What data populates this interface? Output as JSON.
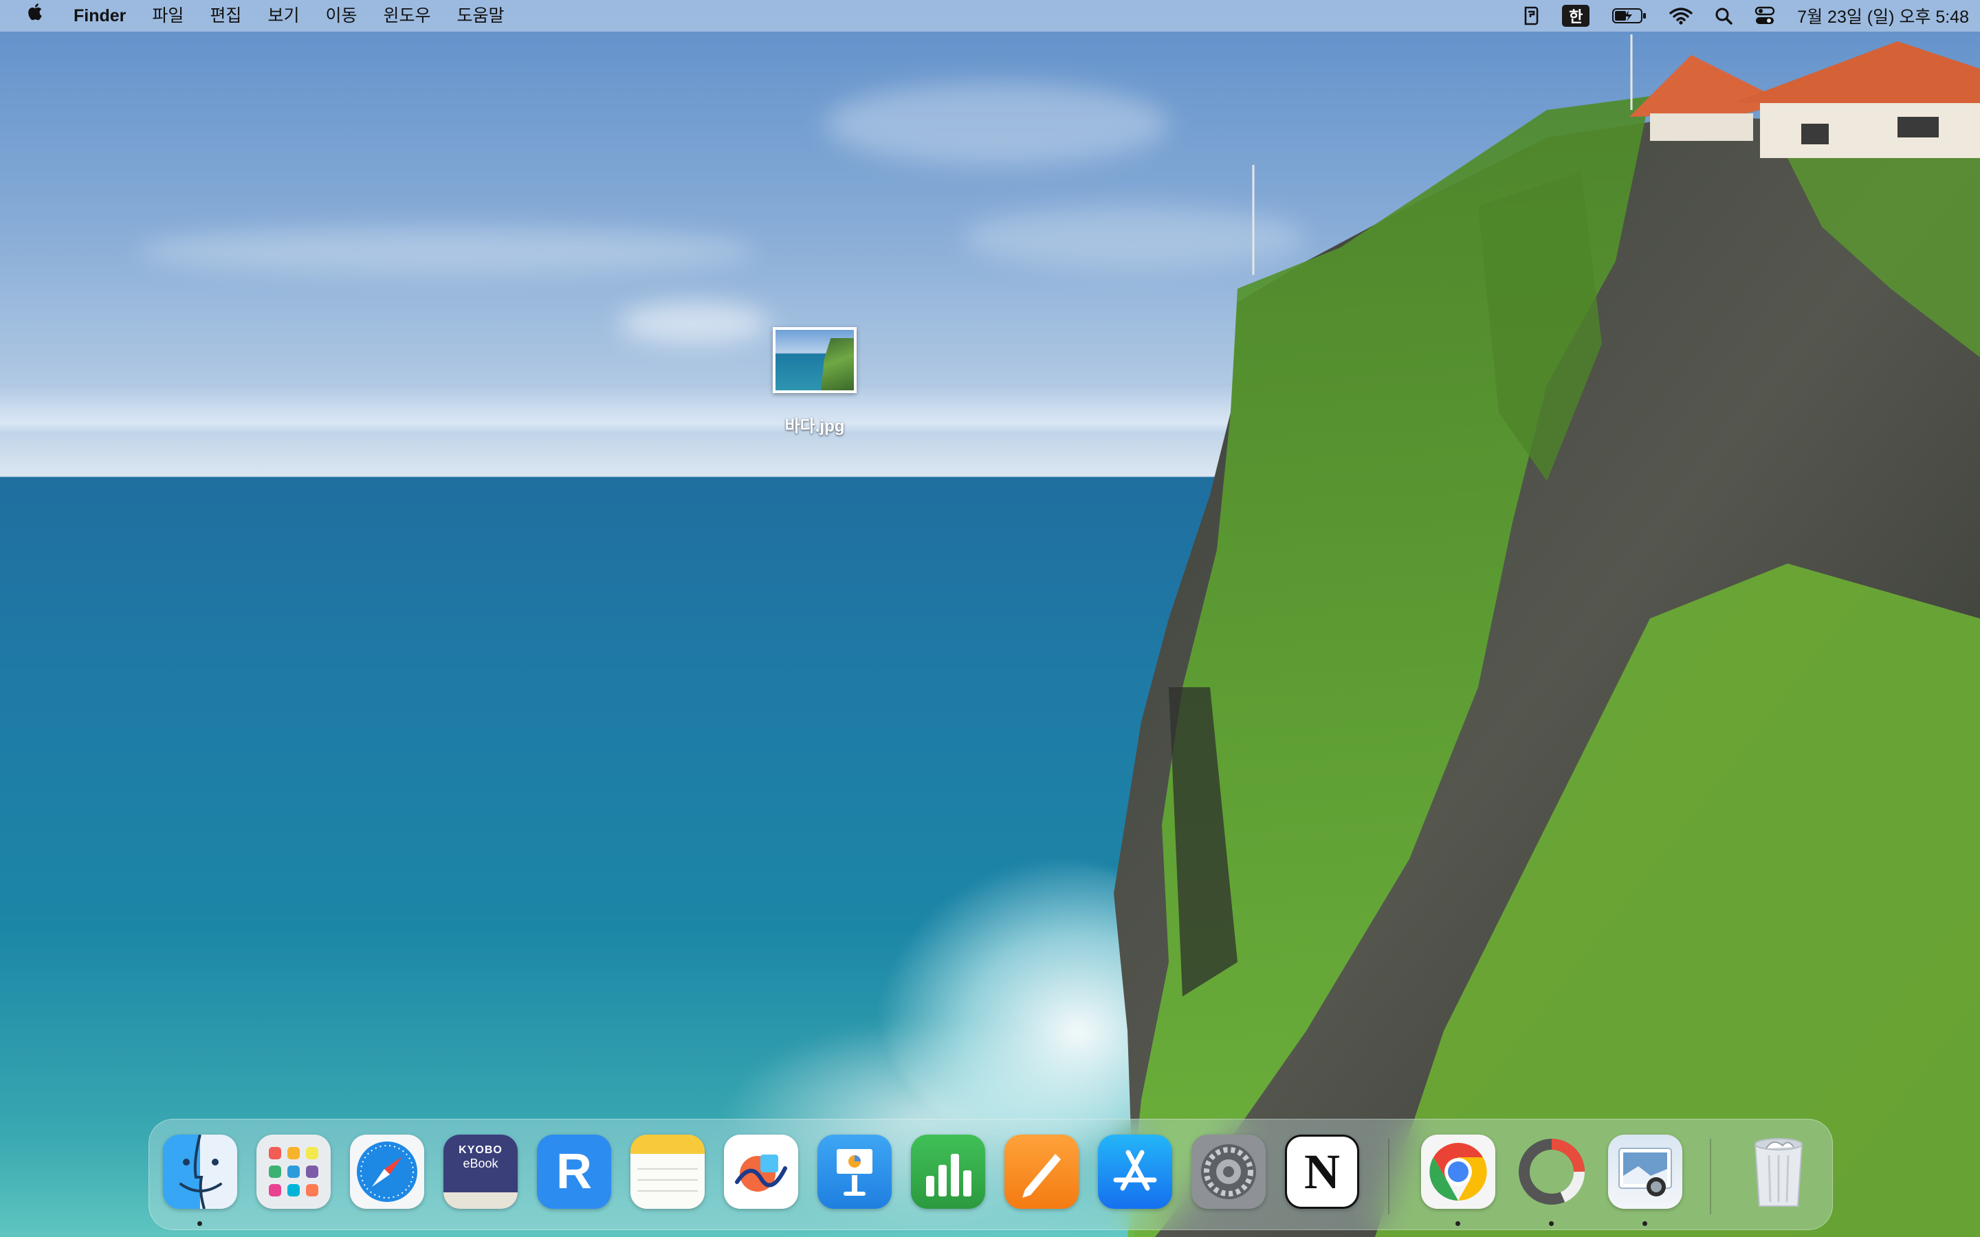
{
  "menubar": {
    "apple_icon": "apple-logo-icon",
    "app_name": "Finder",
    "items": [
      "파일",
      "편집",
      "보기",
      "이동",
      "윈도우",
      "도움말"
    ],
    "status_icons": [
      "shortcut-icon",
      "input-source-icon",
      "battery-icon",
      "wifi-icon",
      "spotlight-search-icon",
      "control-center-icon"
    ],
    "input_source": "한",
    "clock": "7월 23일 (일) 오후 5:48"
  },
  "desktop": {
    "file_name": "바다.jpg"
  },
  "dock": {
    "apps": [
      {
        "name": "Finder",
        "icon": "finder-icon",
        "running": true
      },
      {
        "name": "Launchpad",
        "icon": "launchpad-icon",
        "running": false
      },
      {
        "name": "Safari",
        "icon": "safari-icon",
        "running": false
      },
      {
        "name": "KYOBO eBook",
        "icon": "kyobo-ebook-icon",
        "running": false,
        "label_line1": "KYOBO",
        "label_line2": "eBook"
      },
      {
        "name": "R",
        "icon": "r-app-icon",
        "running": false,
        "letter": "R"
      },
      {
        "name": "Notes",
        "icon": "notes-icon",
        "running": false
      },
      {
        "name": "Freeform",
        "icon": "freeform-icon",
        "running": false
      },
      {
        "name": "Keynote",
        "icon": "keynote-icon",
        "running": false
      },
      {
        "name": "Numbers",
        "icon": "numbers-icon",
        "running": false
      },
      {
        "name": "Pages",
        "icon": "pages-icon",
        "running": false
      },
      {
        "name": "App Store",
        "icon": "app-store-icon",
        "running": false
      },
      {
        "name": "System Settings",
        "icon": "system-settings-icon",
        "running": false
      },
      {
        "name": "Notion",
        "icon": "notion-icon",
        "running": false,
        "letter": "N"
      }
    ],
    "recent_apps": [
      {
        "name": "Google Chrome",
        "icon": "chrome-icon",
        "running": true
      },
      {
        "name": "Screen Recorder",
        "icon": "ring-app-icon",
        "running": true
      },
      {
        "name": "Preview",
        "icon": "preview-icon",
        "running": true
      }
    ],
    "trash": {
      "name": "Trash",
      "icon": "trash-icon"
    }
  }
}
